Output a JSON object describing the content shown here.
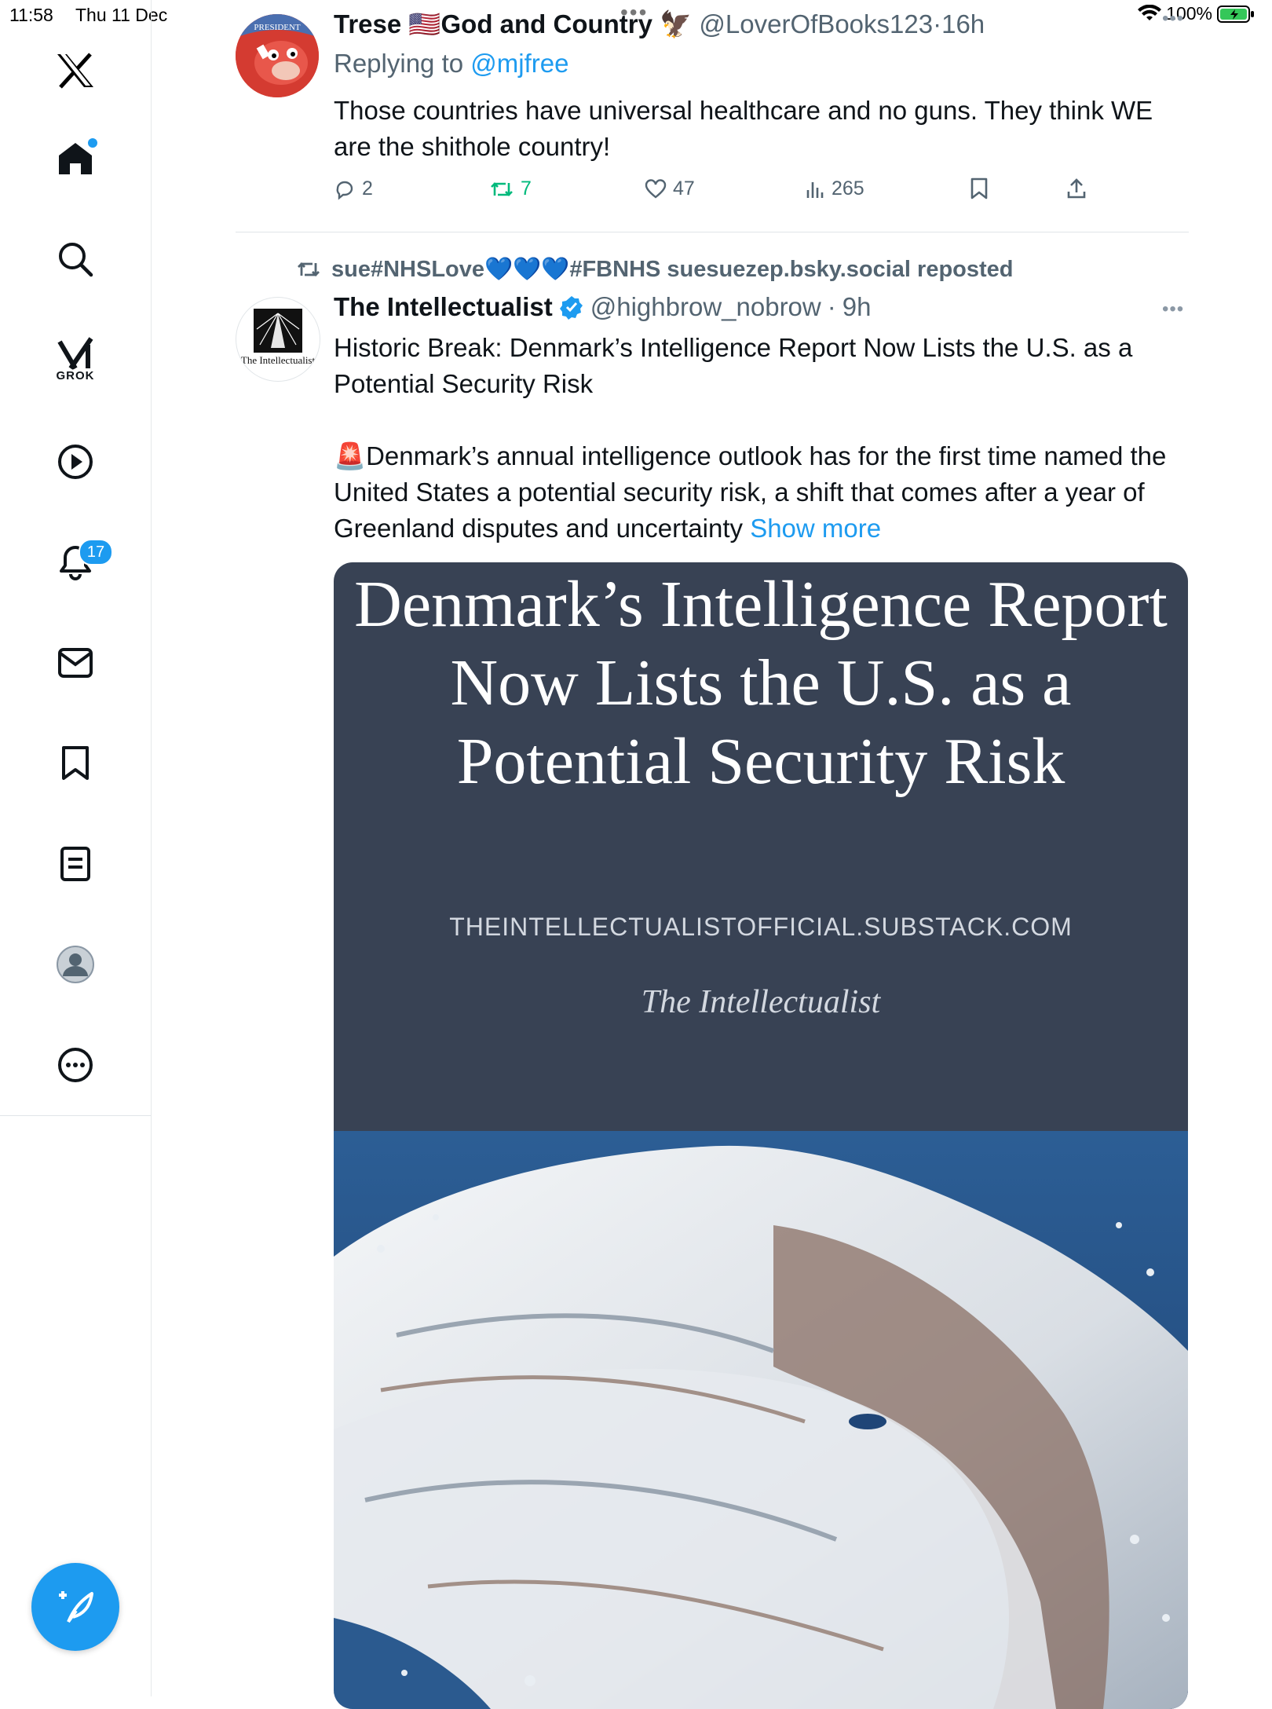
{
  "status_bar": {
    "time": "11:58",
    "date": "Thu 11 Dec",
    "battery": "100%"
  },
  "sidebar": {
    "grok_label": "GROK",
    "notifications_badge": "17"
  },
  "tweet1": {
    "avatar_text": "PRESIDENT",
    "name": "Trese 🇺🇸God and Country",
    "handle": "@LoverOfBooks123",
    "time": "16h",
    "replying_prefix": "Replying to ",
    "replying_to": "@mjfree",
    "text": "Those countries have universal healthcare and no guns. They think WE are the shithole country!",
    "replies": "2",
    "reposts": "7",
    "likes": "47",
    "views": "265"
  },
  "tweet2": {
    "repost_text": "sue#NHSLove💙💙💙#FBNHS suesuezep.bsky.social reposted",
    "avatar_text": "The Intellectualist",
    "name": "The Intellectualist",
    "handle": "@highbrow_nobrow",
    "time": "9h",
    "text_line1": "Historic Break: Denmark’s Intelligence Report Now Lists the U.S. as a Potential Security Risk",
    "text_line2": "🚨Denmark’s annual intelligence outlook has for the first time named the United States a potential security risk, a shift that comes after a year of Greenland disputes and uncertainty",
    "show_more": "Show more",
    "media": {
      "headline": "Denmark’s Intelligence Report Now Lists the U.S. as a Potential Security Risk",
      "site": "THEINTELLECTUALISTOFFICIAL.SUBSTACK.COM",
      "brand": "The Intellectualist"
    }
  },
  "colors": {
    "accent": "#1d9bf0",
    "repost_green": "#00ba7c",
    "muted": "#536471",
    "media_bg": "#384254"
  }
}
